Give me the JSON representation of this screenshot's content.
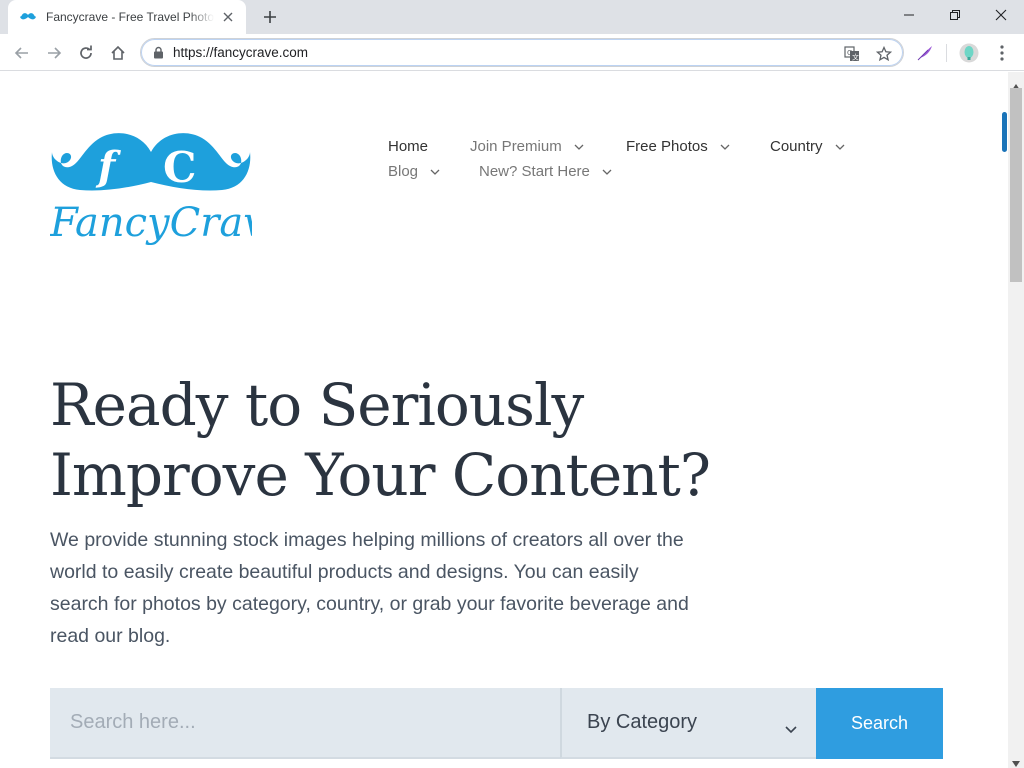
{
  "browser": {
    "tab_title": "Fancycrave - Free Travel Photos for Commercial Use",
    "url": "https://fancycrave.com",
    "accent_color": "#1a73e8"
  },
  "site": {
    "logo_text": "FancyCrave",
    "logo_initials": "fC",
    "brand_color": "#1ea0dc",
    "nav": {
      "row1": [
        {
          "label": "Home",
          "dropdown": false
        },
        {
          "label": "Join Premium",
          "dropdown": true
        },
        {
          "label": "Free Photos",
          "dropdown": true
        },
        {
          "label": "Country",
          "dropdown": true
        }
      ],
      "row2": [
        {
          "label": "Blog",
          "dropdown": true
        },
        {
          "label": "New? Start Here",
          "dropdown": true
        }
      ]
    },
    "hero": {
      "title_line1": "Ready to Seriously",
      "title_line2": "Improve Your Content?",
      "description": "We provide stunning stock images helping millions of creators all over the world to easily create beautiful products and designs. You can easily search for photos by category, country, or grab your favorite beverage and read our blog."
    },
    "search": {
      "placeholder": "Search here...",
      "category_selected": "By Category",
      "button_label": "Search",
      "button_color": "#2f9de0"
    }
  },
  "icons": [
    "mustache-favicon-icon",
    "close-icon",
    "plus-icon",
    "minimize-icon",
    "restore-icon",
    "window-close-icon",
    "back-arrow-icon",
    "forward-arrow-icon",
    "reload-icon",
    "home-icon",
    "lock-icon",
    "translate-icon",
    "star-icon",
    "feather-extension-icon",
    "avatar-icon",
    "kebab-menu-icon",
    "chevron-down-icon"
  ]
}
